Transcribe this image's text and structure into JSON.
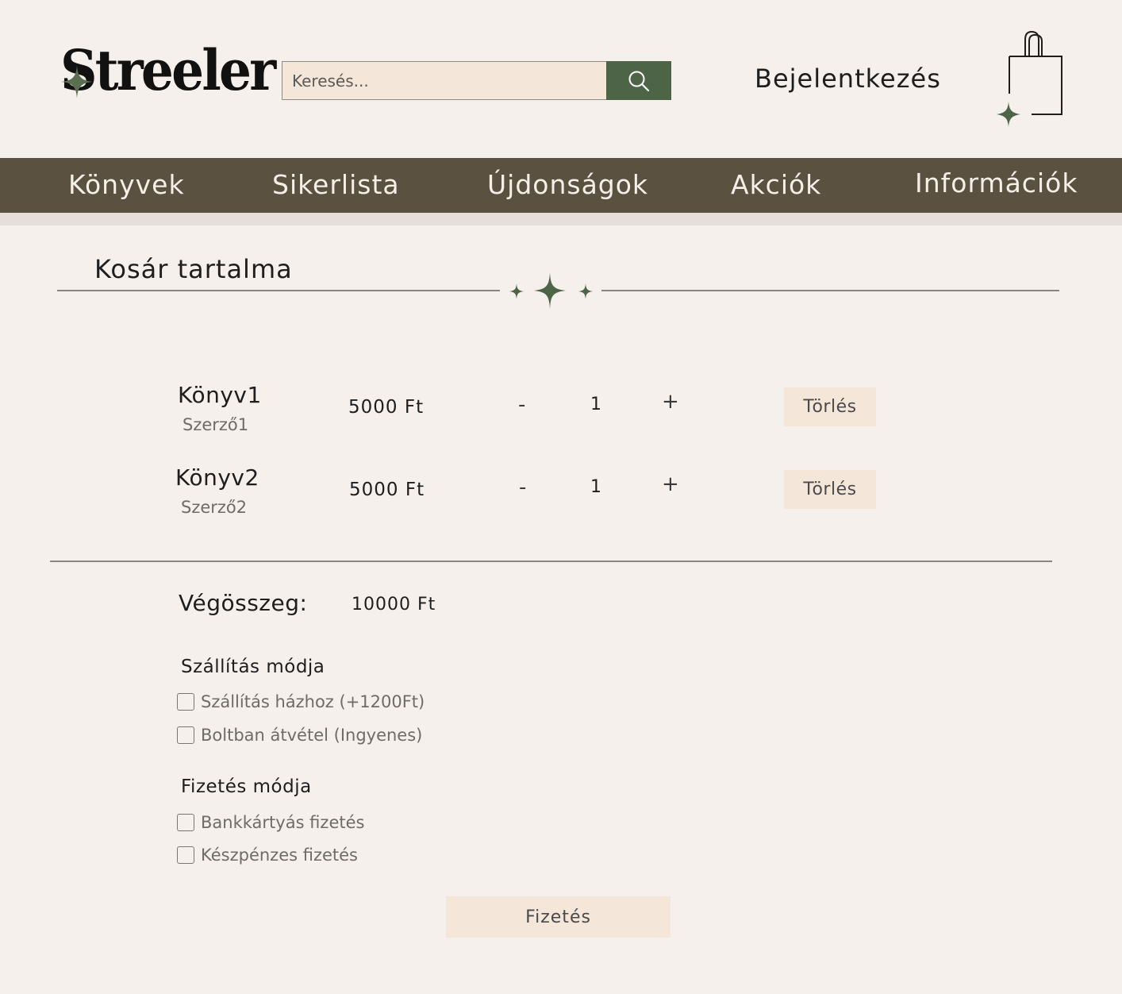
{
  "header": {
    "logo_text": "Streeler",
    "search_placeholder": "Keresés...",
    "login_label": "Bejelentkezés",
    "icons": {
      "search": "search-icon",
      "cart": "shopping-bag-icon",
      "sparkle": "sparkle-icon"
    },
    "accent_color": "#4e6447"
  },
  "nav": {
    "items": [
      {
        "label": "Könyvek"
      },
      {
        "label": "Sikerlista"
      },
      {
        "label": "Újdonságok"
      },
      {
        "label": "Akciók"
      },
      {
        "label": "Információk"
      }
    ],
    "background": "#5b5140"
  },
  "cart": {
    "title": "Kosár tartalma",
    "items": [
      {
        "title": "Könyv1",
        "author": "Szerző1",
        "price": "5000 Ft",
        "minus": "-",
        "quantity": "1",
        "plus": "+",
        "delete_label": "Törlés"
      },
      {
        "title": "Könyv2",
        "author": "Szerző2",
        "price": "5000 Ft",
        "minus": "-",
        "quantity": "1",
        "plus": "+",
        "delete_label": "Törlés"
      }
    ],
    "total_label": "Végösszeg:",
    "total_value": "10000 Ft"
  },
  "shipping": {
    "title": "Szállítás módja",
    "options": [
      {
        "label": "Szállítás házhoz (+1200Ft)"
      },
      {
        "label": "Boltban átvétel (Ingyenes)"
      }
    ]
  },
  "payment": {
    "title": "Fizetés módja",
    "options": [
      {
        "label": "Bankkártyás fizetés"
      },
      {
        "label": "Készpénzes fizetés"
      }
    ]
  },
  "pay_button_label": "Fizetés"
}
